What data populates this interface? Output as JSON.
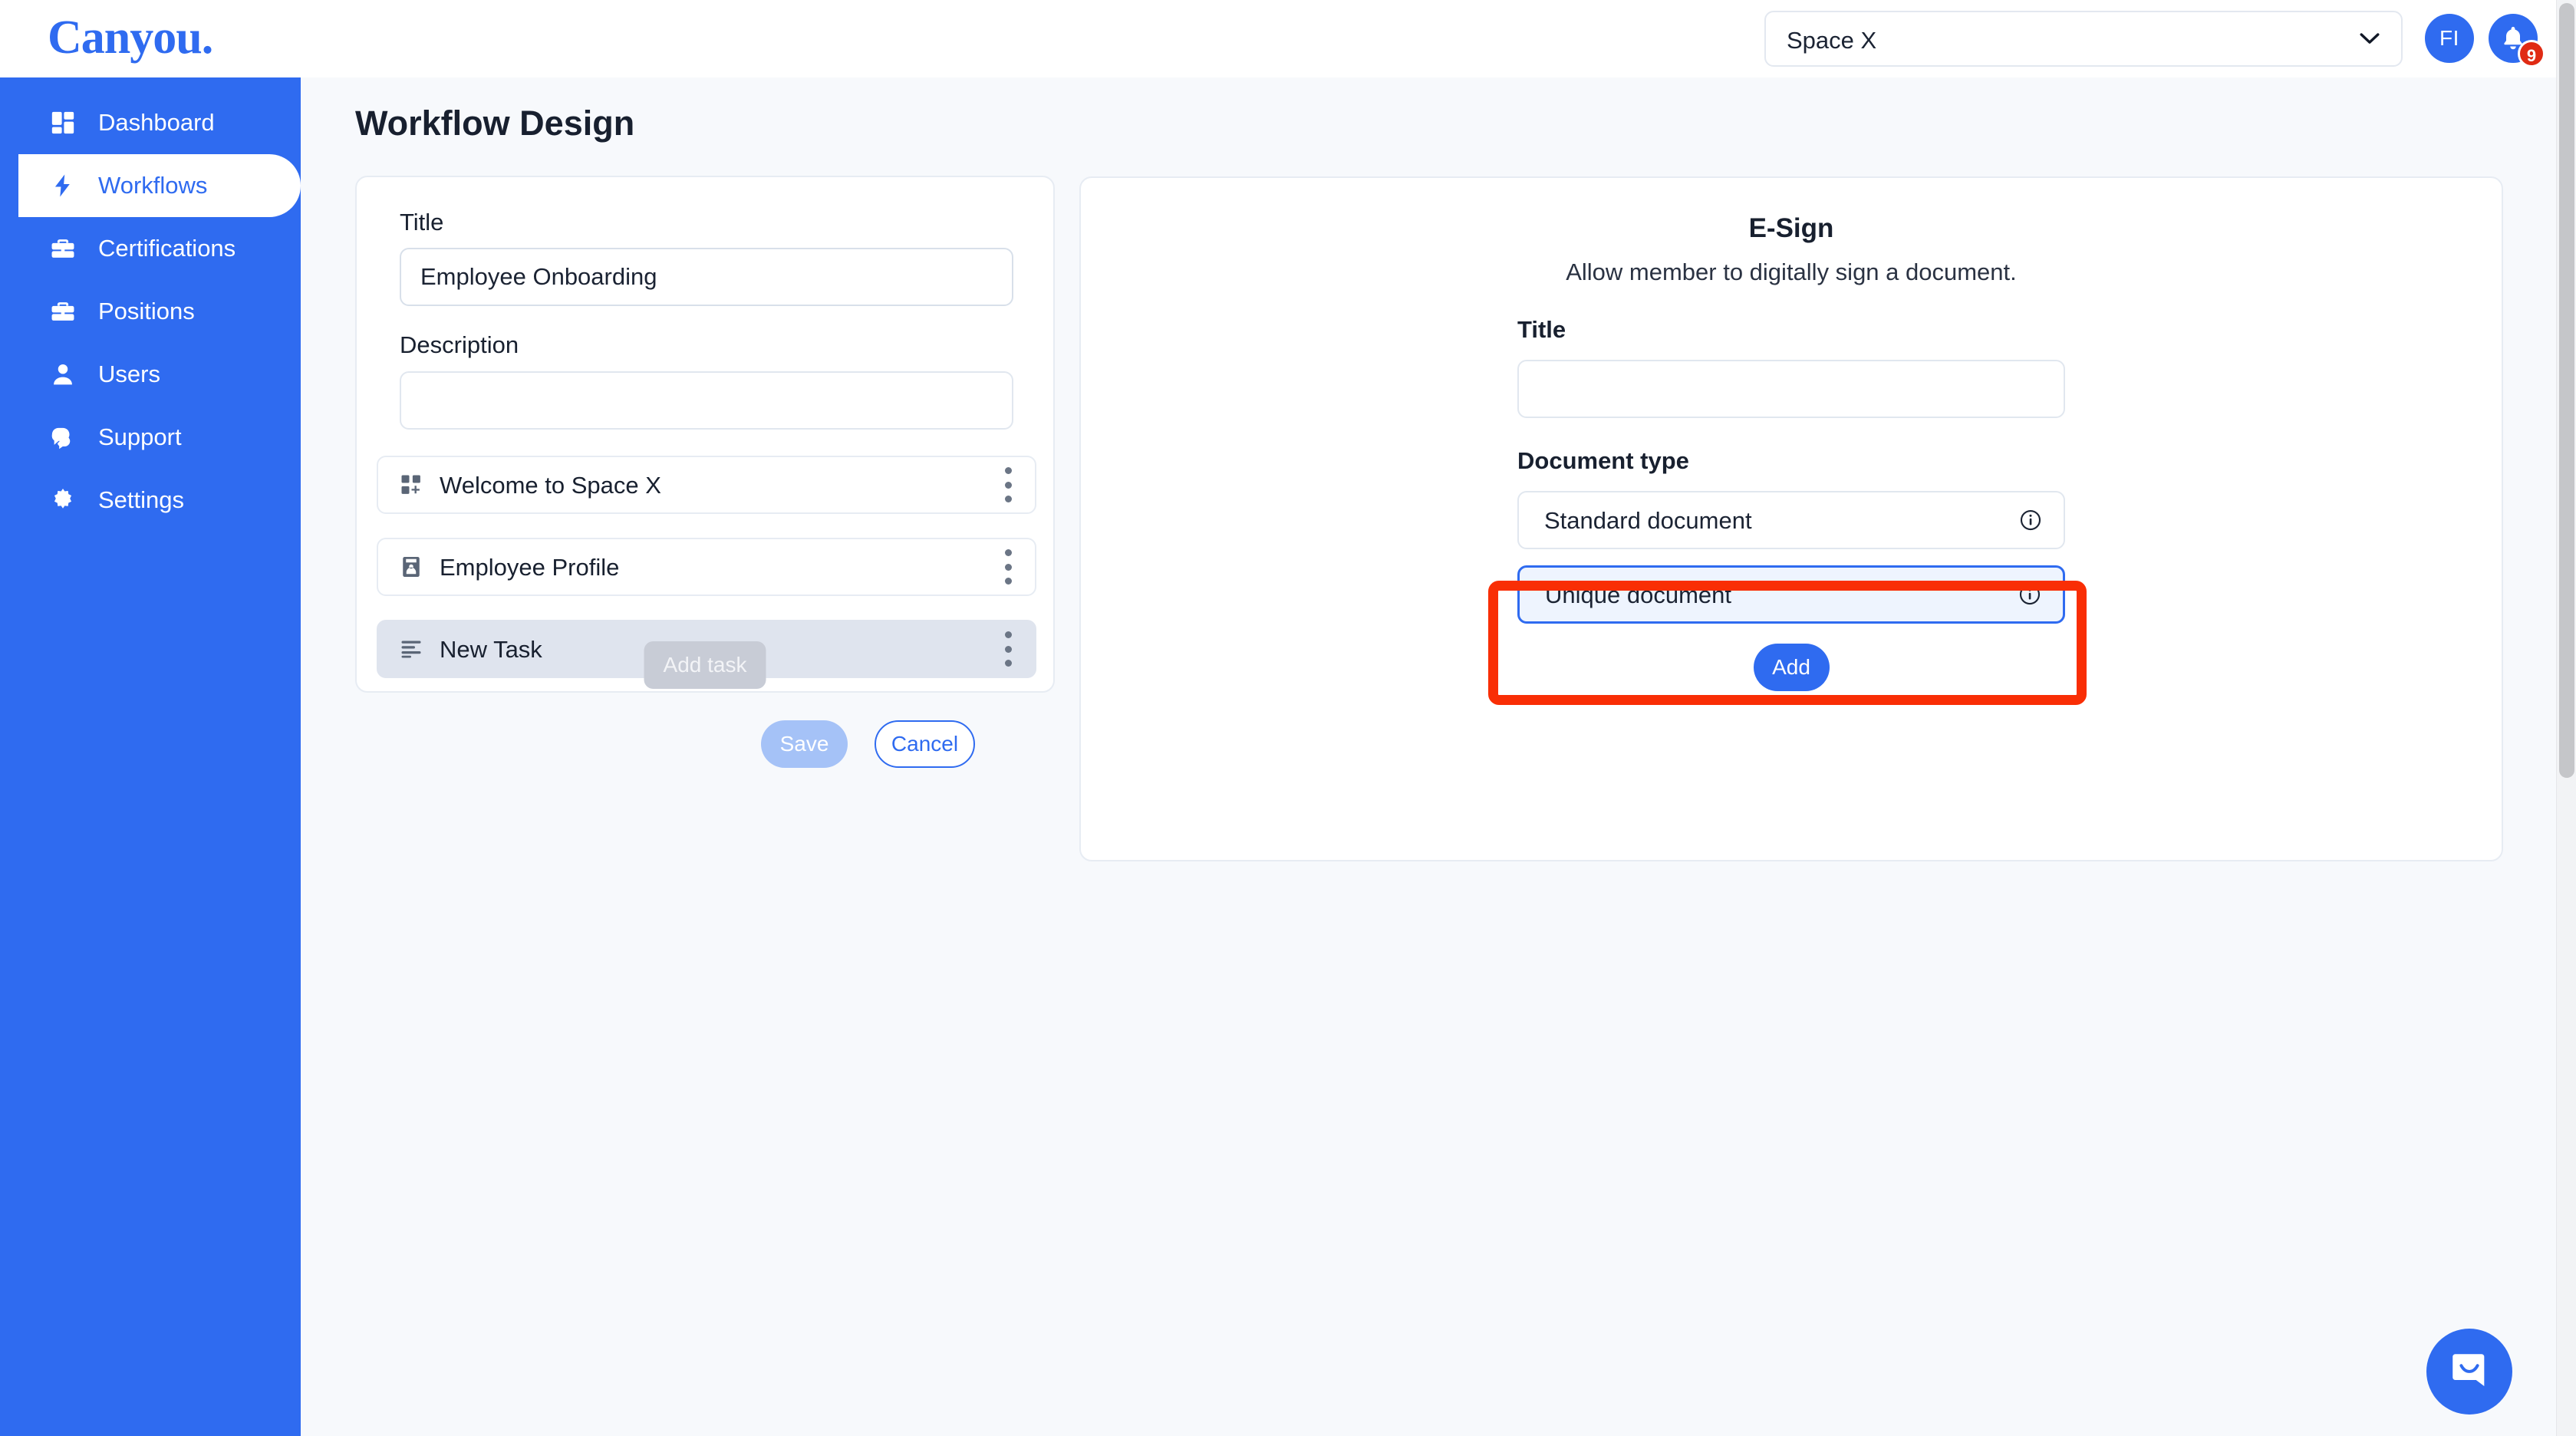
{
  "brand": {
    "logo_text": "Canyou.",
    "primary_color": "#2f6bf0",
    "annotation_color": "#f92e05",
    "danger_color": "#e02b14"
  },
  "header": {
    "space_selector": {
      "value": "Space X",
      "icon": "chevron-down-icon"
    },
    "avatar_initials": "FI",
    "notifications": {
      "icon": "bell-icon",
      "badge_count": "9"
    }
  },
  "sidebar": {
    "items": [
      {
        "label": "Dashboard",
        "icon": "dashboard-icon",
        "active": false
      },
      {
        "label": "Workflows",
        "icon": "lightning-bolt-icon",
        "active": true
      },
      {
        "label": "Certifications",
        "icon": "briefcase-icon",
        "active": false
      },
      {
        "label": "Positions",
        "icon": "briefcase-icon",
        "active": false
      },
      {
        "label": "Users",
        "icon": "user-icon",
        "active": false
      },
      {
        "label": "Support",
        "icon": "chat-question-icon",
        "active": false
      },
      {
        "label": "Settings",
        "icon": "gear-icon",
        "active": false
      }
    ]
  },
  "main": {
    "page_title": "Workflow Design",
    "workflow_form": {
      "title_label": "Title",
      "title_value": "Employee Onboarding",
      "title_placeholder": "",
      "description_label": "Description",
      "description_value": "",
      "description_placeholder": "",
      "tasks": [
        {
          "name": "Welcome to Space X",
          "icon": "dashboard-add-icon",
          "selected": false
        },
        {
          "name": "Employee Profile",
          "icon": "id-card-icon",
          "selected": false
        },
        {
          "name": "New Task",
          "icon": "text-lines-icon",
          "selected": true
        }
      ],
      "add_task_label": "Add task",
      "save_label": "Save",
      "cancel_label": "Cancel"
    },
    "esign_panel": {
      "heading": "E-Sign",
      "subtitle": "Allow member to digitally sign a document.",
      "title_label": "Title",
      "title_value": "",
      "title_placeholder": "",
      "document_type_label": "Document type",
      "document_types": [
        {
          "label": "Standard document",
          "selected": false,
          "info_icon": "info-icon"
        },
        {
          "label": "Unique document",
          "selected": true,
          "info_icon": "info-icon"
        }
      ],
      "add_label": "Add"
    }
  },
  "widgets": {
    "chat_launcher_icon": "chat-bubble-icon"
  }
}
